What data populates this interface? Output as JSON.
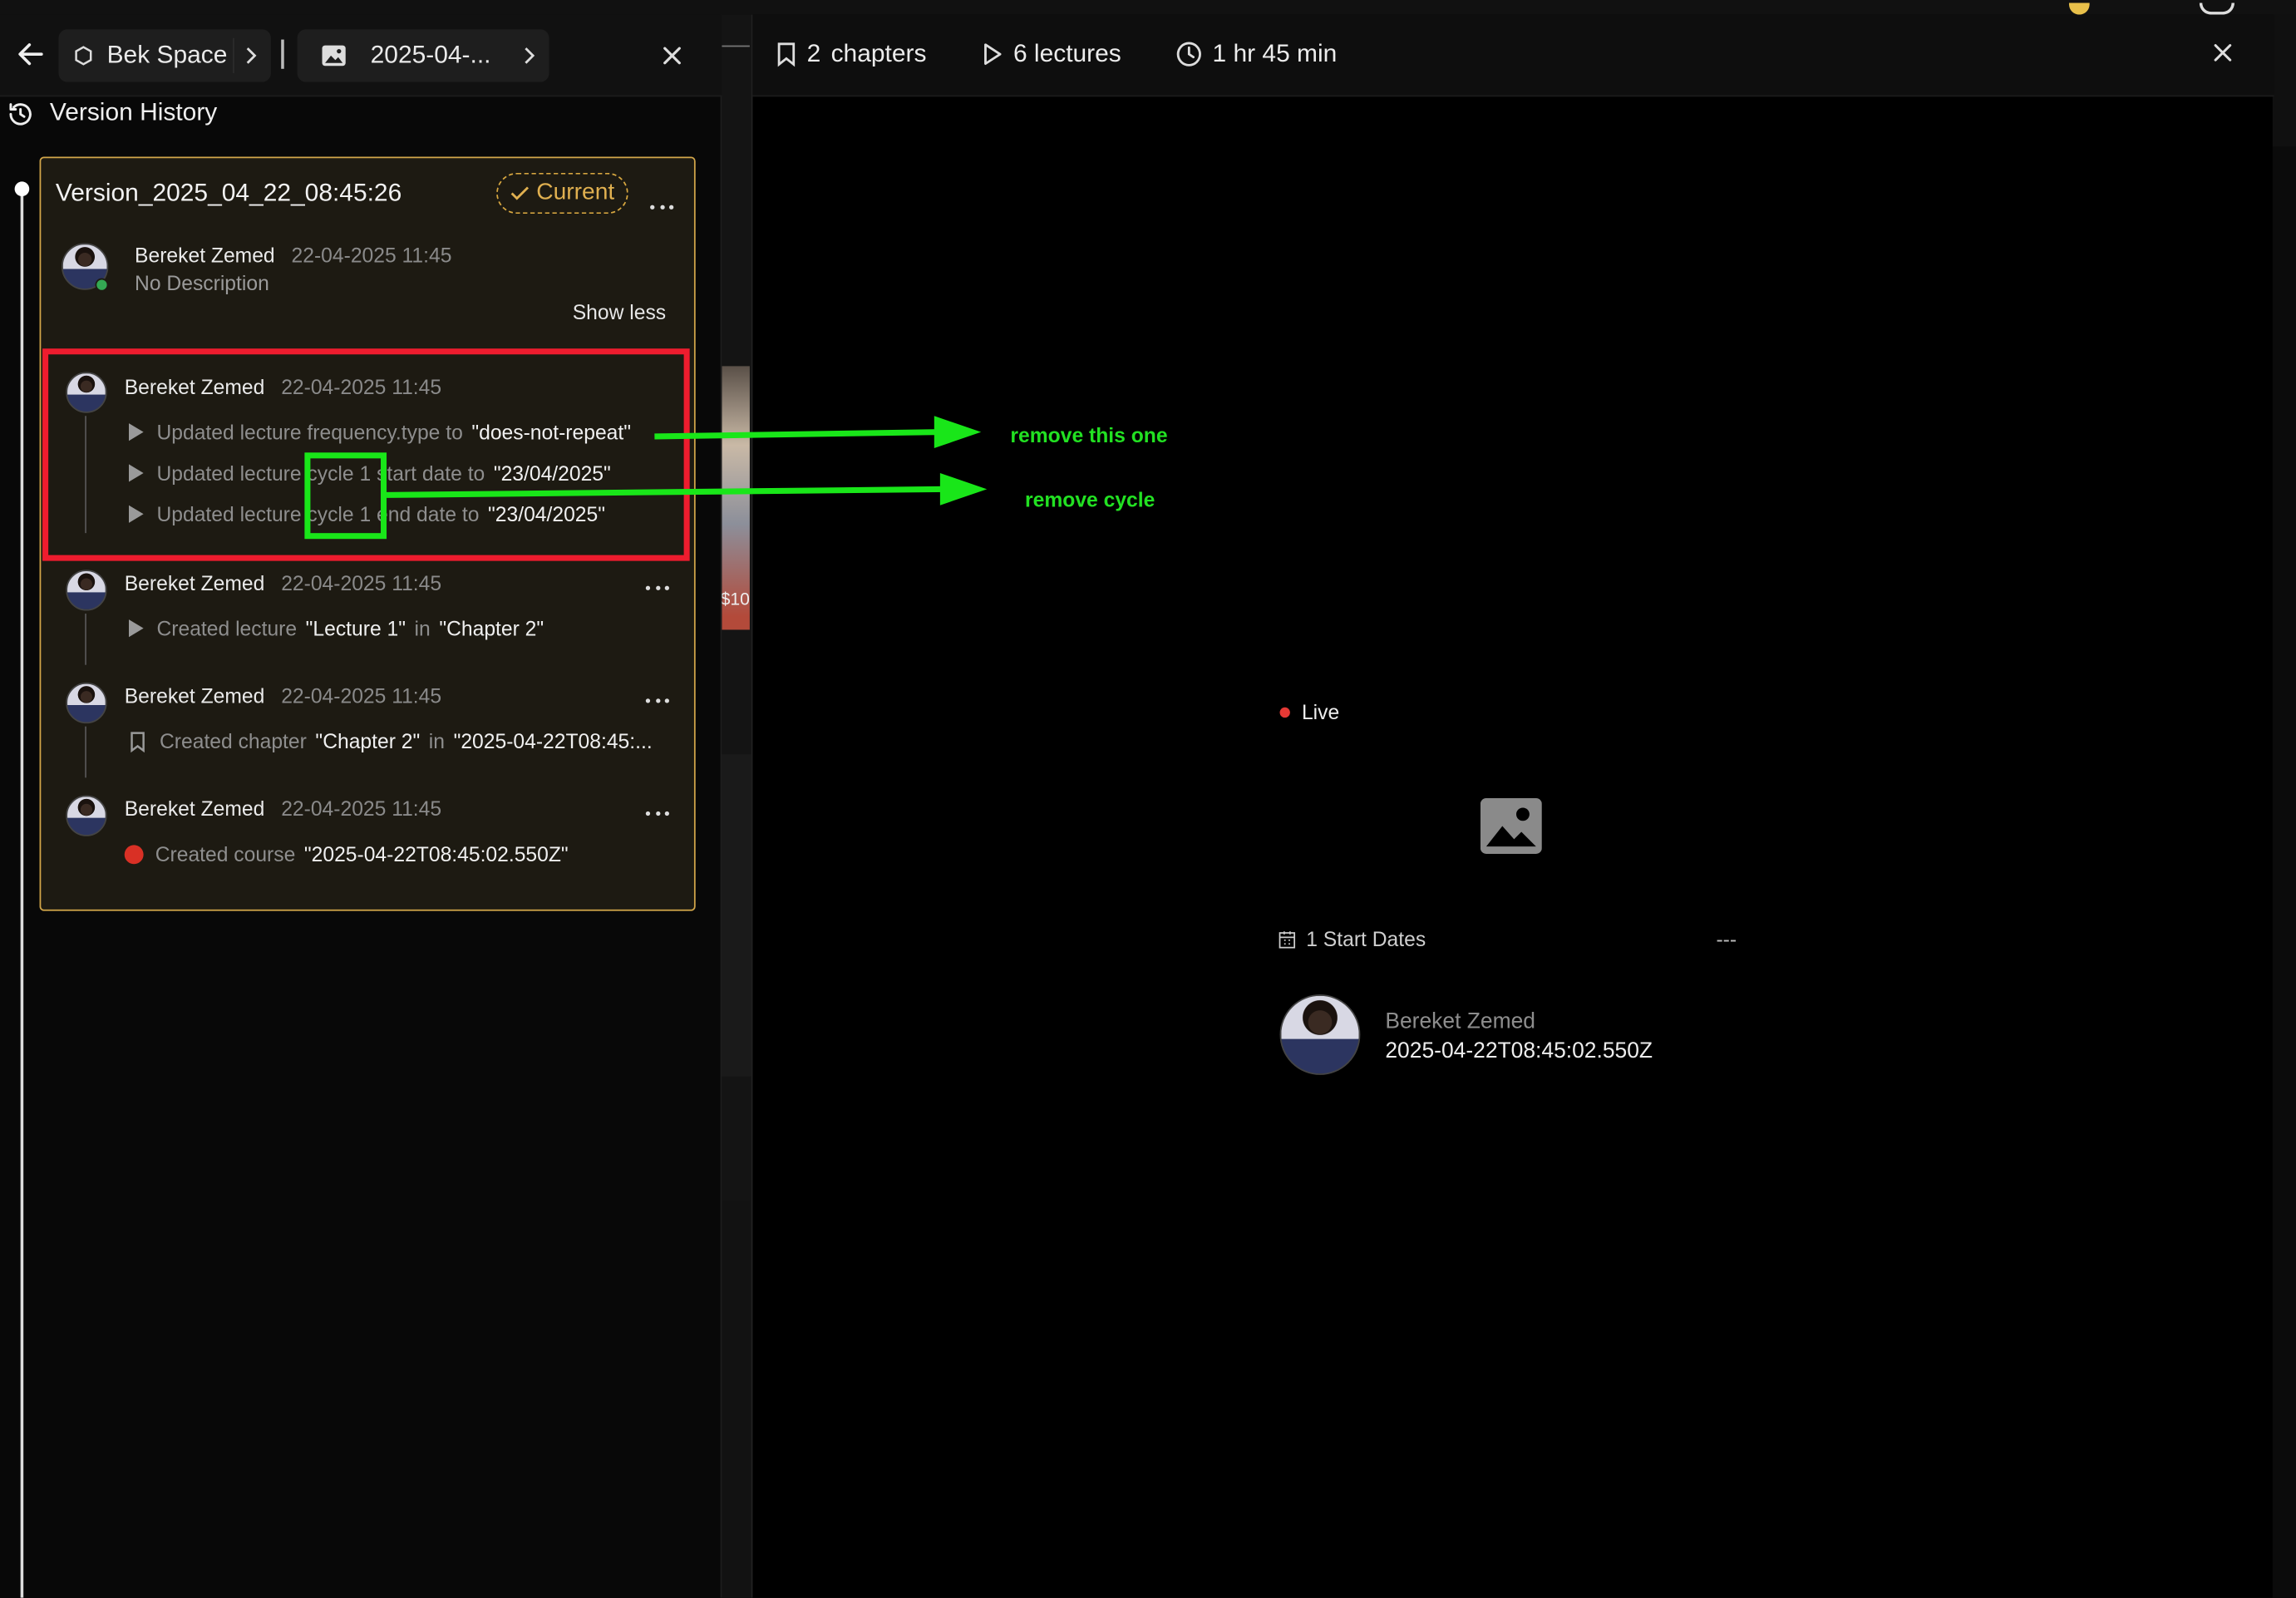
{
  "breadcrumb": {
    "space_label": "Bek Space",
    "course_label": "2025-04-..."
  },
  "version_history": {
    "title": "Version History",
    "version_name": "Version_2025_04_22_08:45:26",
    "current_badge": "Current",
    "author": "Bereket Zemed",
    "date": "22-04-2025 11:45",
    "description": "No Description",
    "show_less": "Show less",
    "entries": [
      {
        "author": "Bereket Zemed",
        "date": "22-04-2025 11:45",
        "items": [
          {
            "icon": "play-icon",
            "text": "Updated lecture frequency.type to",
            "value": "\"does-not-repeat\""
          },
          {
            "icon": "play-icon",
            "text": "Updated lecture cycle 1 start date to",
            "value": "\"23/04/2025\""
          },
          {
            "icon": "play-icon",
            "text": "Updated lecture cycle 1 end date to",
            "value": "\"23/04/2025\""
          }
        ]
      },
      {
        "author": "Bereket Zemed",
        "date": "22-04-2025 11:45",
        "items": [
          {
            "icon": "play-icon",
            "text": "Created lecture",
            "value": "\"Lecture 1\"",
            "text2": "in",
            "value2": "\"Chapter 2\""
          }
        ]
      },
      {
        "author": "Bereket Zemed",
        "date": "22-04-2025 11:45",
        "items": [
          {
            "icon": "bookmark-icon",
            "text": "Created chapter",
            "value": "\"Chapter 2\"",
            "text2": "in",
            "value2": "\"2025-04-22T08:45:..."
          }
        ]
      },
      {
        "author": "Bereket Zemed",
        "date": "22-04-2025 11:45",
        "items": [
          {
            "icon": "red-dot-icon",
            "text": "Created course",
            "value": "\"2025-04-22T08:45:02.550Z\""
          }
        ]
      }
    ]
  },
  "annotations": {
    "remove_this_one": "remove this one",
    "remove_cycle": "remove cycle"
  },
  "course": {
    "chapters_count": "2",
    "chapters_label": "chapters",
    "lectures": "6 lectures",
    "duration": "1 hr 45 min",
    "status": "Live",
    "start_dates": "1 Start Dates",
    "start_dates_value": "---",
    "author": "Bereket Zemed",
    "created": "2025-04-22T08:45:02.550Z"
  },
  "peek_price_text": "$10",
  "colors": {
    "card_border": "#d2a64a",
    "badge": "#e0b050",
    "annotation_red": "#ee1c2e",
    "annotation_green": "#19e619",
    "live_dot": "#e53935",
    "course_dot": "#d93025"
  }
}
